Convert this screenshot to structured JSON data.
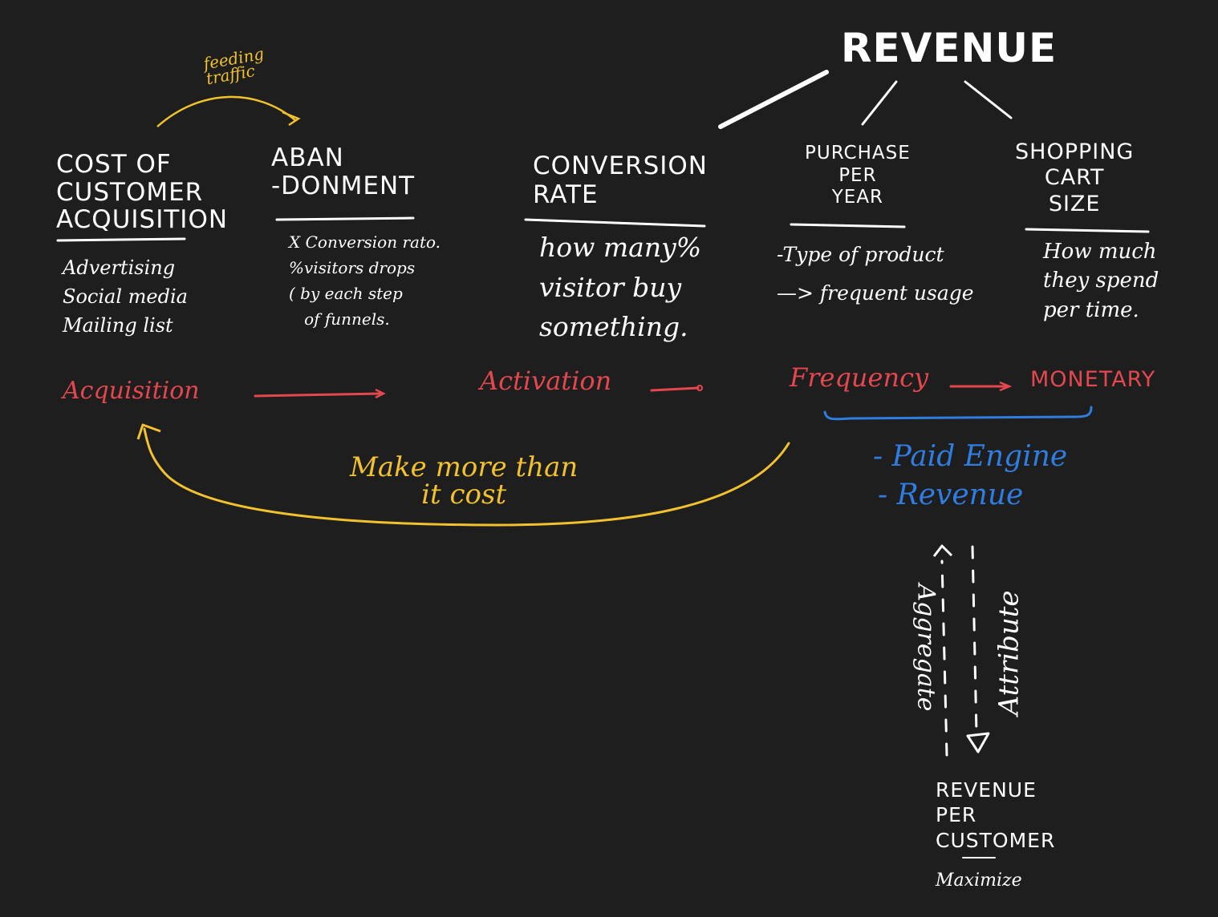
{
  "title": "REVENUE",
  "top_annotation": "feeding\ntraffic",
  "columns": [
    {
      "heading": "COST OF\nCUSTOMER\nACQUISITION",
      "notes": "Advertising\nSocial media\nMailing list"
    },
    {
      "heading": "ABAN\n-DONMENT",
      "notes": "X Conversion rato.\n%visitors drops\n( by each step\n   of funnels."
    },
    {
      "heading": "CONVERSION\nRATE",
      "notes": "how many%\nvisitor buy\nsomething."
    },
    {
      "heading": "PURCHASE\nPER\nYEAR",
      "notes": "-Type of product\n—> frequent usage"
    },
    {
      "heading": "SHOPPING\nCART\nSIZE",
      "notes": "How much\nthey spend\nper time."
    }
  ],
  "stages": {
    "acquisition": "Acquisition",
    "activation": "Activation",
    "frequency": "Frequency",
    "monetary": "MONETARY"
  },
  "loop_label": "Make more than\nit cost",
  "blue_list": {
    "item1": "- Paid Engine",
    "item2": "- Revenue"
  },
  "vertical_labels": {
    "left": "Aggregate",
    "right": "Attribute"
  },
  "bottom": {
    "label": "REVENUE\nPER\nCUSTOMER",
    "note": "Maximize"
  },
  "colors": {
    "background": "#1e1e1e",
    "white": "#ffffff",
    "red": "#e5474f",
    "yellow": "#f2c12e",
    "blue": "#2f7de1"
  }
}
